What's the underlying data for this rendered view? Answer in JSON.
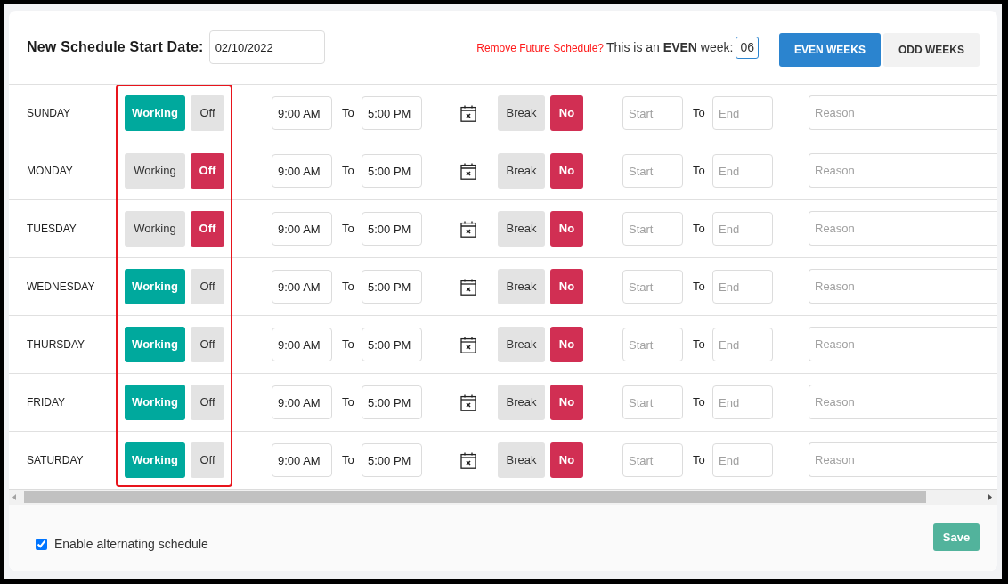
{
  "header": {
    "title": "New Schedule Start Date:",
    "start_date": {
      "value": "02/10/2022"
    },
    "remove_link": "Remove Future Schedule?",
    "week_notice": "This is an **EVEN** week:",
    "week_number": "06",
    "week_tabs": [
      {
        "label": "EVEN WEEKS",
        "selected": true
      },
      {
        "label": "ODD WEEKS",
        "selected": false
      }
    ]
  },
  "rows": [
    {
      "day": "SUNDAY",
      "status": [
        {
          "label": "Working",
          "selected": true
        },
        {
          "label": "Off",
          "selected": false
        }
      ],
      "start_time": {
        "value": "9:00 AM"
      },
      "to_label": "To",
      "end_time": {
        "value": "5:00 PM"
      },
      "break": [
        {
          "label": "Break",
          "selected": false
        },
        {
          "label": "No",
          "selected": true
        }
      ],
      "break_start": {
        "placeholder": "Start"
      },
      "break_to_label": "To",
      "break_end": {
        "placeholder": "End"
      },
      "reason": {
        "placeholder": "Reason"
      }
    },
    {
      "day": "MONDAY",
      "status": [
        {
          "label": "Working",
          "selected": false
        },
        {
          "label": "Off",
          "selected": true
        }
      ],
      "start_time": {
        "value": "9:00 AM"
      },
      "to_label": "To",
      "end_time": {
        "value": "5:00 PM"
      },
      "break": [
        {
          "label": "Break",
          "selected": false
        },
        {
          "label": "No",
          "selected": true
        }
      ],
      "break_start": {
        "placeholder": "Start"
      },
      "break_to_label": "To",
      "break_end": {
        "placeholder": "End"
      },
      "reason": {
        "placeholder": "Reason"
      }
    },
    {
      "day": "TUESDAY",
      "status": [
        {
          "label": "Working",
          "selected": false
        },
        {
          "label": "Off",
          "selected": true
        }
      ],
      "start_time": {
        "value": "9:00 AM"
      },
      "to_label": "To",
      "end_time": {
        "value": "5:00 PM"
      },
      "break": [
        {
          "label": "Break",
          "selected": false
        },
        {
          "label": "No",
          "selected": true
        }
      ],
      "break_start": {
        "placeholder": "Start"
      },
      "break_to_label": "To",
      "break_end": {
        "placeholder": "End"
      },
      "reason": {
        "placeholder": "Reason"
      }
    },
    {
      "day": "WEDNESDAY",
      "status": [
        {
          "label": "Working",
          "selected": true
        },
        {
          "label": "Off",
          "selected": false
        }
      ],
      "start_time": {
        "value": "9:00 AM"
      },
      "to_label": "To",
      "end_time": {
        "value": "5:00 PM"
      },
      "break": [
        {
          "label": "Break",
          "selected": false
        },
        {
          "label": "No",
          "selected": true
        }
      ],
      "break_start": {
        "placeholder": "Start"
      },
      "break_to_label": "To",
      "break_end": {
        "placeholder": "End"
      },
      "reason": {
        "placeholder": "Reason"
      }
    },
    {
      "day": "THURSDAY",
      "status": [
        {
          "label": "Working",
          "selected": true
        },
        {
          "label": "Off",
          "selected": false
        }
      ],
      "start_time": {
        "value": "9:00 AM"
      },
      "to_label": "To",
      "end_time": {
        "value": "5:00 PM"
      },
      "break": [
        {
          "label": "Break",
          "selected": false
        },
        {
          "label": "No",
          "selected": true
        }
      ],
      "break_start": {
        "placeholder": "Start"
      },
      "break_to_label": "To",
      "break_end": {
        "placeholder": "End"
      },
      "reason": {
        "placeholder": "Reason"
      }
    },
    {
      "day": "FRIDAY",
      "status": [
        {
          "label": "Working",
          "selected": true
        },
        {
          "label": "Off",
          "selected": false
        }
      ],
      "start_time": {
        "value": "9:00 AM"
      },
      "to_label": "To",
      "end_time": {
        "value": "5:00 PM"
      },
      "break": [
        {
          "label": "Break",
          "selected": false
        },
        {
          "label": "No",
          "selected": true
        }
      ],
      "break_start": {
        "placeholder": "Start"
      },
      "break_to_label": "To",
      "break_end": {
        "placeholder": "End"
      },
      "reason": {
        "placeholder": "Reason"
      }
    },
    {
      "day": "SATURDAY",
      "status": [
        {
          "label": "Working",
          "selected": true
        },
        {
          "label": "Off",
          "selected": false
        }
      ],
      "start_time": {
        "value": "9:00 AM"
      },
      "to_label": "To",
      "end_time": {
        "value": "5:00 PM"
      },
      "break": [
        {
          "label": "Break",
          "selected": false
        },
        {
          "label": "No",
          "selected": true
        }
      ],
      "break_start": {
        "placeholder": "Start"
      },
      "break_to_label": "To",
      "break_end": {
        "placeholder": "End"
      },
      "reason": {
        "placeholder": "Reason"
      }
    }
  ],
  "footer": {
    "alternating_schedule": {
      "label": "Enable alternating schedule",
      "checked": true
    },
    "save_button": "Save"
  }
}
